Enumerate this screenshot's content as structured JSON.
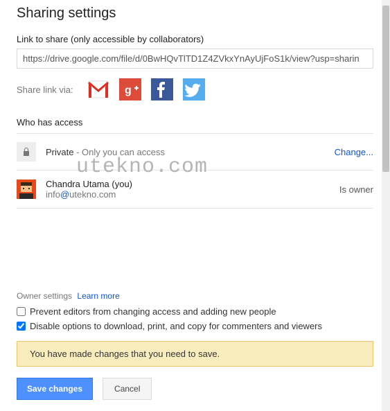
{
  "title": "Sharing settings",
  "linkSection": {
    "label": "Link to share (only accessible by collaborators)",
    "url": "https://drive.google.com/file/d/0BwHQvTlTD1Z4ZVkxYnAyUjFoS1k/view?usp=sharin"
  },
  "shareVia": {
    "label": "Share link via:"
  },
  "accessSection": {
    "header": "Who has access",
    "privacy": {
      "label": "Private",
      "detail": " - Only you can access",
      "changeLabel": "Change..."
    },
    "owner": {
      "name": "Chandra Utama (you)",
      "emailLocal": "info",
      "emailDomain": "utekno.com",
      "role": "Is owner"
    }
  },
  "watermark": "utekno.com",
  "ownerSettings": {
    "label": "Owner settings",
    "learnMore": "Learn more",
    "preventEditors": {
      "label": "Prevent editors from changing access and adding new people",
      "checked": false
    },
    "disableOptions": {
      "label": "Disable options to download, print, and copy for commenters and viewers",
      "checked": true
    }
  },
  "notice": "You have made changes that you need to save.",
  "buttons": {
    "save": "Save changes",
    "cancel": "Cancel"
  }
}
